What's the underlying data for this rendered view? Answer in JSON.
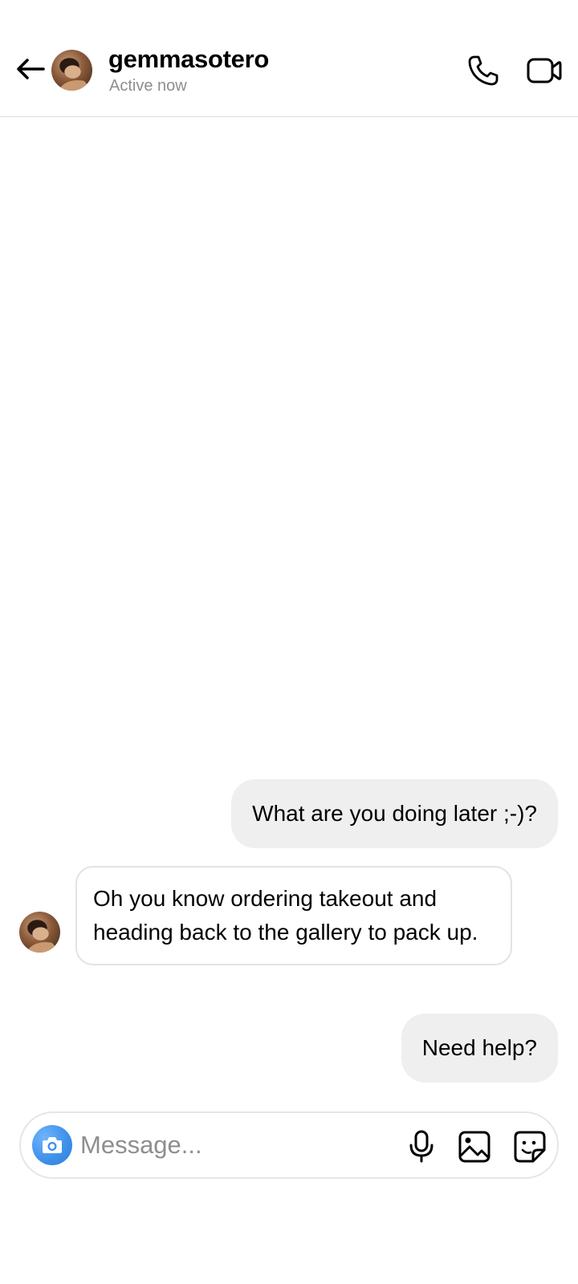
{
  "header": {
    "username": "gemmasotero",
    "status": "Active now",
    "icons": {
      "back": "arrow-left-icon",
      "call": "phone-icon",
      "video": "video-camera-icon"
    }
  },
  "messages": [
    {
      "direction": "sent",
      "text": "What are you doing later ;-)?"
    },
    {
      "direction": "received",
      "text": "Oh you know ordering takeout and heading back to the gallery to pack up."
    },
    {
      "direction": "sent",
      "text": "Need help?"
    }
  ],
  "composer": {
    "placeholder": "Message...",
    "icons": [
      "camera-icon",
      "microphone-icon",
      "image-icon",
      "sticker-icon"
    ]
  },
  "colors": {
    "sent_bubble": "#efefef",
    "received_border": "#e3e3e3",
    "camera_accent": "#3d8fe8",
    "secondary_text": "#8e8e8e"
  }
}
